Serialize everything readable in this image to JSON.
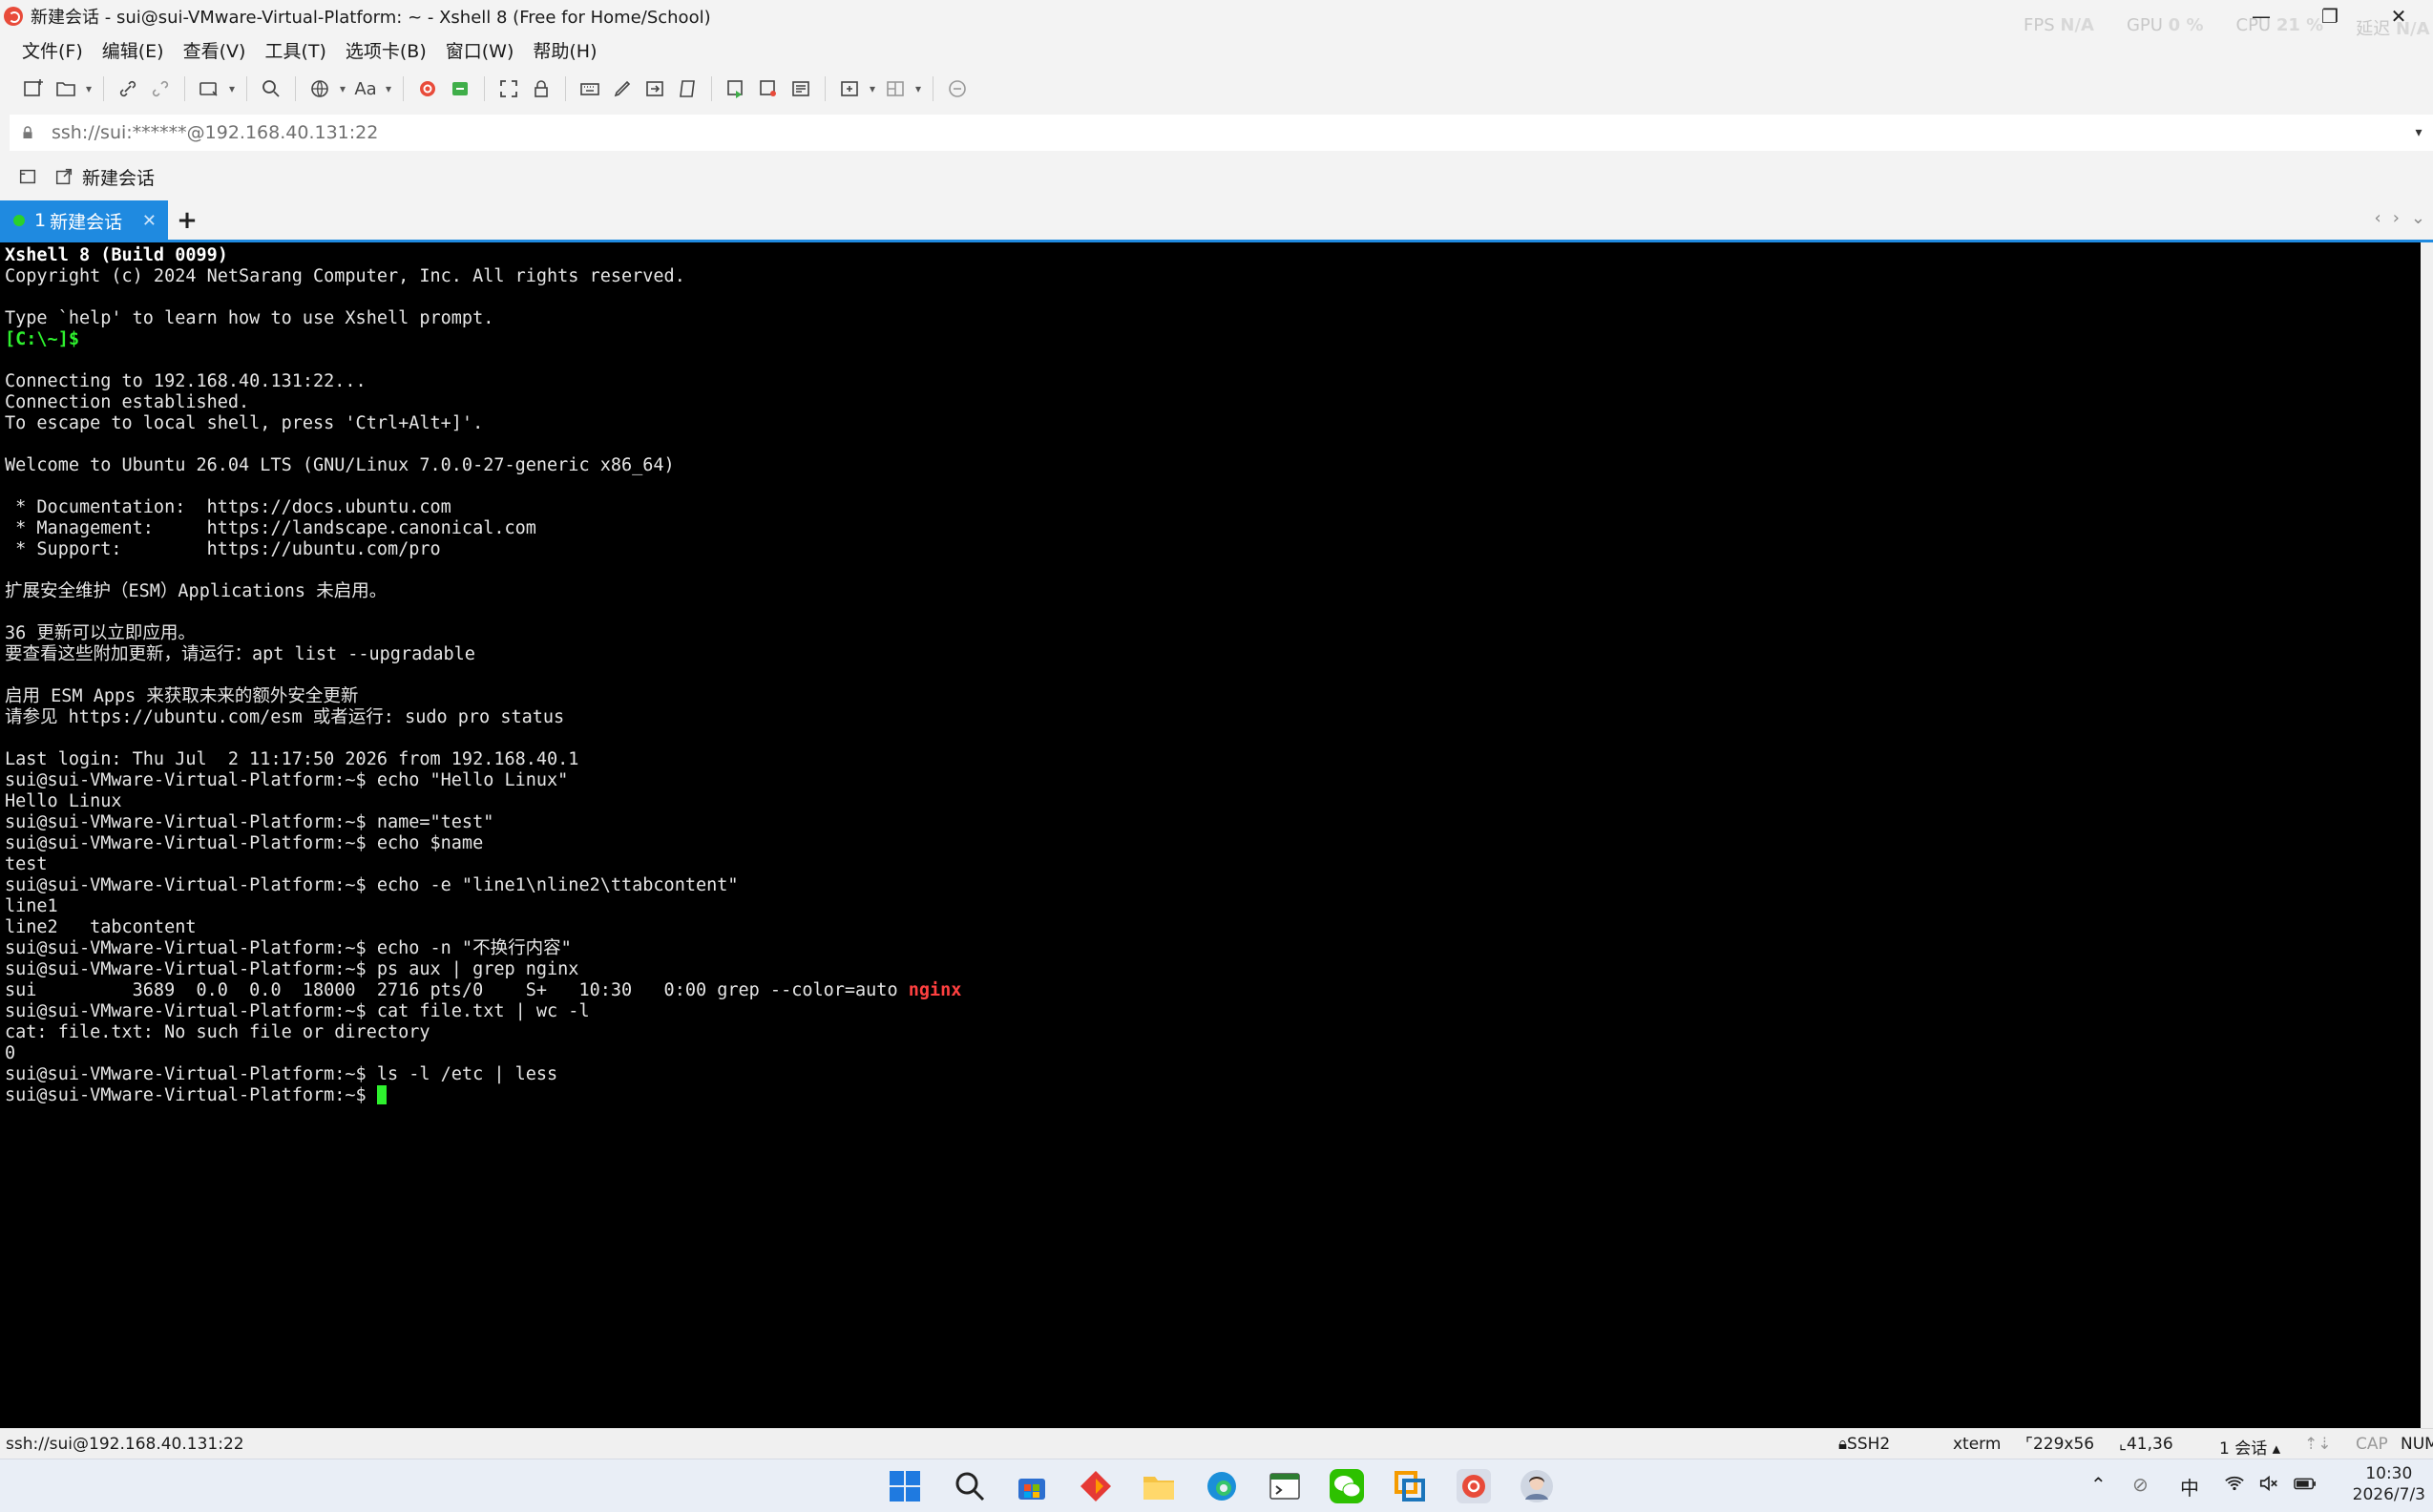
{
  "window": {
    "title": "新建会话 - sui@sui-VMware-Virtual-Platform: ~ - Xshell 8 (Free for Home/School)",
    "perf": {
      "fps_label": "FPS",
      "fps_value": "N/A",
      "gpu_label": "GPU",
      "gpu_value": "0 %",
      "cpu_label": "CPU",
      "cpu_value": "21 %",
      "mem_label": "延迟",
      "mem_value": "N/A"
    },
    "controls": {
      "minimize": "—",
      "restore": "❐",
      "close": "✕"
    }
  },
  "menu": [
    "文件(F)",
    "编辑(E)",
    "查看(V)",
    "工具(T)",
    "选项卡(B)",
    "窗口(W)",
    "帮助(H)"
  ],
  "address": {
    "value": "ssh://sui:******@192.168.40.131:22",
    "caret": "▾"
  },
  "sessionbar": {
    "label": "新建会话"
  },
  "tabs": [
    {
      "number": "1",
      "label": "新建会话",
      "close": "✕",
      "active": true
    }
  ],
  "tab_add": "+",
  "tab_nav": {
    "prev": "‹",
    "next": "›",
    "more": "⌄"
  },
  "terminal": {
    "lines": [
      {
        "segments": [
          {
            "text": "Xshell 8 (Build 0099)",
            "style": "bold"
          }
        ]
      },
      {
        "segments": [
          {
            "text": "Copyright (c) 2024 NetSarang Computer, Inc. All rights reserved."
          }
        ]
      },
      {
        "segments": [
          {
            "text": ""
          }
        ]
      },
      {
        "segments": [
          {
            "text": "Type `help' to learn how to use Xshell prompt."
          }
        ]
      },
      {
        "segments": [
          {
            "text": "[C:\\~]$",
            "style": "green"
          }
        ]
      },
      {
        "segments": [
          {
            "text": ""
          }
        ]
      },
      {
        "segments": [
          {
            "text": "Connecting to 192.168.40.131:22..."
          }
        ]
      },
      {
        "segments": [
          {
            "text": "Connection established."
          }
        ]
      },
      {
        "segments": [
          {
            "text": "To escape to local shell, press 'Ctrl+Alt+]'."
          }
        ]
      },
      {
        "segments": [
          {
            "text": ""
          }
        ]
      },
      {
        "segments": [
          {
            "text": "Welcome to Ubuntu 26.04 LTS (GNU/Linux 7.0.0-27-generic x86_64)"
          }
        ]
      },
      {
        "segments": [
          {
            "text": ""
          }
        ]
      },
      {
        "segments": [
          {
            "text": " * Documentation:  https://docs.ubuntu.com"
          }
        ]
      },
      {
        "segments": [
          {
            "text": " * Management:     https://landscape.canonical.com"
          }
        ]
      },
      {
        "segments": [
          {
            "text": " * Support:        https://ubuntu.com/pro"
          }
        ]
      },
      {
        "segments": [
          {
            "text": ""
          }
        ]
      },
      {
        "segments": [
          {
            "text": "扩展安全维护（ESM）Applications 未启用。"
          }
        ]
      },
      {
        "segments": [
          {
            "text": ""
          }
        ]
      },
      {
        "segments": [
          {
            "text": "36 更新可以立即应用。"
          }
        ]
      },
      {
        "segments": [
          {
            "text": "要查看这些附加更新，请运行：apt list --upgradable"
          }
        ]
      },
      {
        "segments": [
          {
            "text": ""
          }
        ]
      },
      {
        "segments": [
          {
            "text": "启用 ESM Apps 来获取未来的额外安全更新"
          }
        ]
      },
      {
        "segments": [
          {
            "text": "请参见 https://ubuntu.com/esm 或者运行: sudo pro status"
          }
        ]
      },
      {
        "segments": [
          {
            "text": ""
          }
        ]
      },
      {
        "segments": [
          {
            "text": "Last login: Thu Jul  2 11:17:50 2026 from 192.168.40.1"
          }
        ]
      },
      {
        "segments": [
          {
            "text": "sui@sui-VMware-Virtual-Platform:~$ echo \"Hello Linux\""
          }
        ]
      },
      {
        "segments": [
          {
            "text": "Hello Linux"
          }
        ]
      },
      {
        "segments": [
          {
            "text": "sui@sui-VMware-Virtual-Platform:~$ name=\"test\""
          }
        ]
      },
      {
        "segments": [
          {
            "text": "sui@sui-VMware-Virtual-Platform:~$ echo $name"
          }
        ]
      },
      {
        "segments": [
          {
            "text": "test"
          }
        ]
      },
      {
        "segments": [
          {
            "text": "sui@sui-VMware-Virtual-Platform:~$ echo -e \"line1\\nline2\\ttabcontent\""
          }
        ]
      },
      {
        "segments": [
          {
            "text": "line1"
          }
        ]
      },
      {
        "segments": [
          {
            "text": "line2   tabcontent"
          }
        ]
      },
      {
        "segments": [
          {
            "text": "sui@sui-VMware-Virtual-Platform:~$ echo -n \"不换行内容\""
          }
        ]
      },
      {
        "segments": [
          {
            "text": "sui@sui-VMware-Virtual-Platform:~$ ps aux | grep nginx"
          }
        ]
      },
      {
        "segments": [
          {
            "text": "sui         3689  0.0  0.0  18000  2716 pts/0    S+   10:30   0:00 grep --color=auto "
          },
          {
            "text": "nginx",
            "style": "red"
          }
        ]
      },
      {
        "segments": [
          {
            "text": "sui@sui-VMware-Virtual-Platform:~$ cat file.txt | wc -l"
          }
        ]
      },
      {
        "segments": [
          {
            "text": "cat: file.txt: No such file or directory"
          }
        ]
      },
      {
        "segments": [
          {
            "text": "0"
          }
        ]
      },
      {
        "segments": [
          {
            "text": "sui@sui-VMware-Virtual-Platform:~$ ls -l /etc | less"
          }
        ]
      },
      {
        "segments": [
          {
            "text": "sui@sui-VMware-Virtual-Platform:~$ "
          }
        ],
        "cursor": true
      }
    ]
  },
  "status": {
    "connection": "ssh://sui@192.168.40.131:22",
    "protocol": "SSH2",
    "terminal_type": "xterm",
    "size": "229x56",
    "cursor_pos": "41,36",
    "sessions": "1 会话",
    "caps": "CAP",
    "num": "NUM"
  },
  "taskbar": {
    "tray_input": "中",
    "time": "10:30",
    "date": "2026/7/3"
  },
  "colors": {
    "accent": "#1f8ae0",
    "terminal_bg": "#000000",
    "prompt_green": "#2ef02e",
    "match_red": "#ff4040"
  }
}
